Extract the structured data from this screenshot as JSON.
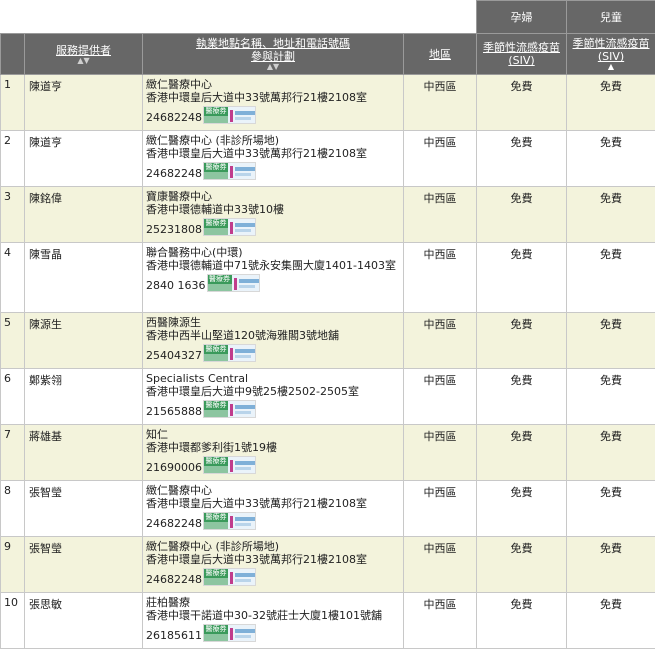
{
  "header_groups": {
    "pregnant": "孕婦",
    "children": "兒童"
  },
  "columns": {
    "provider": "服務提供者",
    "address_line1": "執業地點名稱、地址和電話號碼",
    "address_line2": "參與計劃",
    "district": "地區",
    "preg_line1": "季節性流感疫苗",
    "preg_line2": "(SIV)",
    "child_line1": "季節性流感疫苗",
    "child_line2": "(SIV)"
  },
  "sort_icons": {
    "provider": "▲▼",
    "address": "▲▼",
    "child_active": "▲"
  },
  "badge_text": "醫療券",
  "rows": [
    {
      "num": "1",
      "provider": "陳道亨",
      "clinic": "緻仁醫療中心",
      "address": "香港中環皇后大道中33號萬邦行21樓2108室",
      "phone": "24682248",
      "district": "中西區",
      "preg": "免費",
      "child": "免費"
    },
    {
      "num": "2",
      "provider": "陳道亨",
      "clinic": "緻仁醫療中心 (非診所場地)",
      "address": "香港中環皇后大道中33號萬邦行21樓2108室",
      "phone": "24682248",
      "district": "中西區",
      "preg": "免費",
      "child": "免費"
    },
    {
      "num": "3",
      "provider": "陳銘偉",
      "clinic": "寶康醫療中心",
      "address": "香港中環德輔道中33號10樓",
      "phone": "25231808",
      "district": "中西區",
      "preg": "免費",
      "child": "免費"
    },
    {
      "num": "4",
      "provider": "陳雪晶",
      "clinic": "聯合醫務中心(中環)",
      "address": "香港中環德輔道中71號永安集團大廈1401-1403室",
      "phone": "2840 1636",
      "district": "中西區",
      "preg": "免費",
      "child": "免費"
    },
    {
      "num": "5",
      "provider": "陳源生",
      "clinic": "西醫陳源生",
      "address": "香港中西半山堅道120號海雅閣3號地舖",
      "phone": "25404327",
      "district": "中西區",
      "preg": "免費",
      "child": "免費"
    },
    {
      "num": "6",
      "provider": "鄭紫翎",
      "clinic": "Specialists Central",
      "address": "香港中環皇后大道中9號25樓2502-2505室",
      "phone": "21565888",
      "district": "中西區",
      "preg": "免費",
      "child": "免費"
    },
    {
      "num": "7",
      "provider": "蔣雄基",
      "clinic": "知仁",
      "address": "香港中環都爹利街1號19樓",
      "phone": "21690006",
      "district": "中西區",
      "preg": "免費",
      "child": "免費"
    },
    {
      "num": "8",
      "provider": "張智瑩",
      "clinic": "緻仁醫療中心",
      "address": "香港中環皇后大道中33號萬邦行21樓2108室",
      "phone": "24682248",
      "district": "中西區",
      "preg": "免費",
      "child": "免費"
    },
    {
      "num": "9",
      "provider": "張智瑩",
      "clinic": "緻仁醫療中心 (非診所場地)",
      "address": "香港中環皇后大道中33號萬邦行21樓2108室",
      "phone": "24682248",
      "district": "中西區",
      "preg": "免費",
      "child": "免費"
    },
    {
      "num": "10",
      "provider": "張思敏",
      "clinic": "莊柏醫療",
      "address": "香港中環干諾道中30-32號莊士大廈1樓101號舖",
      "phone": "26185611",
      "district": "中西區",
      "preg": "免費",
      "child": "免費"
    }
  ]
}
